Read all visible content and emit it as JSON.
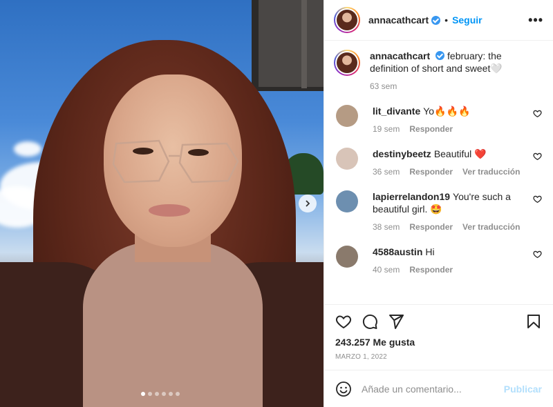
{
  "post": {
    "username": "annacathcart",
    "follow_label": "Seguir",
    "separator": "•",
    "more_icon": "more-horizontal-icon",
    "more_label": "•••"
  },
  "caption": {
    "username": "annacathcart",
    "text": "february: the definition of short and sweet🤍",
    "time": "63 sem"
  },
  "comments": [
    {
      "username": "lit_divante",
      "text": "Yo🔥🔥🔥",
      "time": "19 sem",
      "reply": "Responder",
      "translate": "",
      "avatar_color": "#b59b84"
    },
    {
      "username": "destinybeetz",
      "text": "Beautiful ❤️",
      "time": "36 sem",
      "reply": "Responder",
      "translate": "Ver traducción",
      "avatar_color": "#d8c4b8"
    },
    {
      "username": "lapierrelandon19",
      "text": "You're such a beautiful girl. 🤩",
      "time": "38 sem",
      "reply": "Responder",
      "translate": "Ver traducción",
      "avatar_color": "#6d8fb0"
    },
    {
      "username": "4588austin",
      "text": "Hi",
      "time": "40 sem",
      "reply": "Responder",
      "translate": "",
      "avatar_color": "#8a7a6c"
    }
  ],
  "actions": {
    "like_icon": "heart-icon",
    "comment_icon": "comment-icon",
    "share_icon": "send-icon",
    "save_icon": "bookmark-icon",
    "likes": "243.257 Me gusta",
    "date": "MARZO 1, 2022"
  },
  "add_comment": {
    "placeholder": "Añade un comentario...",
    "emoji_icon": "emoji-icon",
    "publish_label": "Publicar"
  },
  "carousel": {
    "slide_count": 6,
    "active_index": 0,
    "next_icon": "chevron-right-icon"
  },
  "colors": {
    "accent": "#0095f6",
    "publish_disabled": "#b2dffc",
    "meta": "#8e8e8e",
    "verified": "#3897f0"
  }
}
